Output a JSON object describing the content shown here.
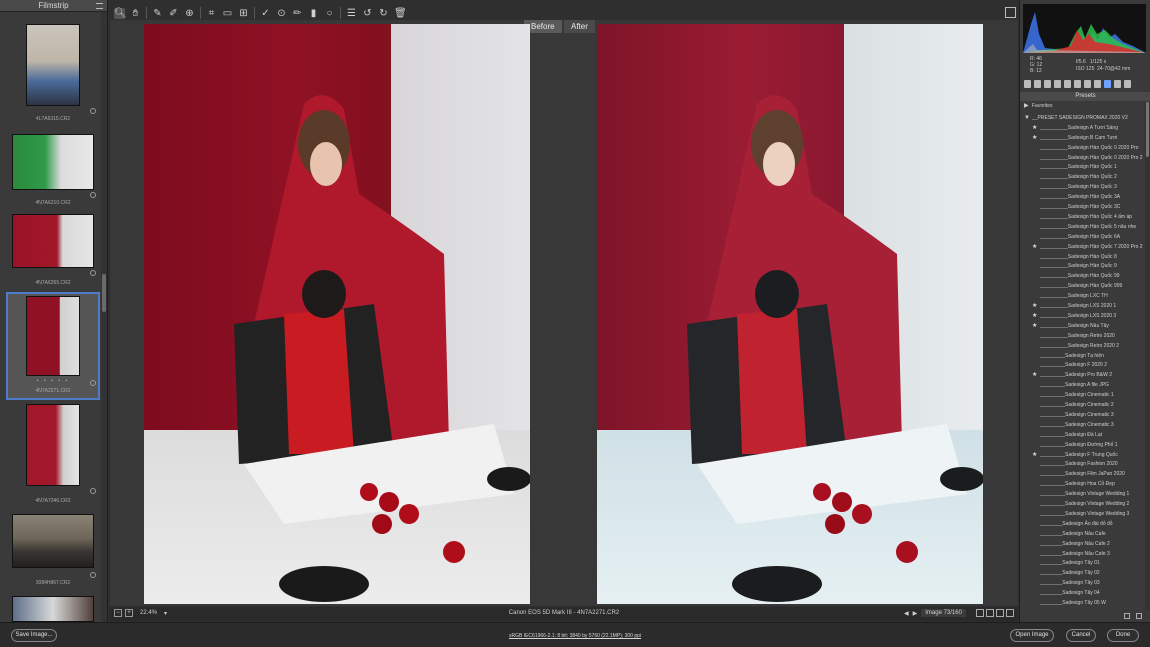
{
  "filmstrip": {
    "title": "Filmstrip",
    "thumbnails": [
      {
        "caption": "4L7A6315.CR2",
        "stars": ""
      },
      {
        "caption": "4N7A6210.CR2",
        "stars": ""
      },
      {
        "caption": "4N7A6265.CR2",
        "stars": ""
      },
      {
        "caption": "4N7A2271.CR2",
        "stars": "• • • • •"
      },
      {
        "caption": "4N7A7346.CR2",
        "stars": ""
      },
      {
        "caption": "3084H867.CR2",
        "stars": ""
      }
    ]
  },
  "compare": {
    "before_label": "Before",
    "after_label": "After"
  },
  "status": {
    "zoom": "22.4%",
    "camera": "Canon EOS 5D Mark III  -  4N7A2271.CR2",
    "counter": "Image 73/160"
  },
  "readout": {
    "r_label": "R:",
    "r_value": "46",
    "g_label": "G:",
    "g_value": "12",
    "b_label": "B:",
    "b_value": "12",
    "aperture": "f/5.6",
    "shutter": "1/125 s",
    "iso": "ISO 125",
    "lens": "24-70@42 mm"
  },
  "presets": {
    "title": "Presets",
    "favorites_label": "Favorites",
    "group_label": "__PRESET SADESIGN PROMAX 2020 V2",
    "items": [
      {
        "label": "__________Sadesign A Tươi Sáng",
        "star": true
      },
      {
        "label": "__________Sadesign B  Cam Tươi",
        "star": true
      },
      {
        "label": "__________Sadesign Hàn Quốc 0 2020 Pro",
        "star": false
      },
      {
        "label": "__________Sadesign Hàn Quốc 0 2020 Pro 2",
        "star": false
      },
      {
        "label": "__________Sadesign Hàn Quốc 1",
        "star": false
      },
      {
        "label": "__________Sadesign Hàn Quốc 2",
        "star": false
      },
      {
        "label": "__________Sadesign Hàn Quốc 3",
        "star": false
      },
      {
        "label": "__________Sadesign Hàn Quốc 3A",
        "star": false
      },
      {
        "label": "__________Sadesign Hàn Quốc 3C",
        "star": false
      },
      {
        "label": "__________Sadesign Hàn Quốc 4 ấm áp",
        "star": false
      },
      {
        "label": "__________Sadesign Hàn Quốc 5 nâu nhẹ",
        "star": false
      },
      {
        "label": "__________Sadesign Hàn Quốc 6A",
        "star": false
      },
      {
        "label": "__________Sadesign Hàn Quốc 7 2020 Pro 2",
        "star": true
      },
      {
        "label": "__________Sadesign Hàn Quốc 8",
        "star": false
      },
      {
        "label": "__________Sadesign Hàn Quốc 9",
        "star": false
      },
      {
        "label": "__________Sadesign Hàn Quốc 99",
        "star": false
      },
      {
        "label": "__________Sadesign Hàn Quốc 999",
        "star": false
      },
      {
        "label": "__________Sadesign LXC  TH",
        "star": false
      },
      {
        "label": "__________Sadesign LXS 2020 1",
        "star": true
      },
      {
        "label": "__________Sadesign LXS 2020 3",
        "star": true
      },
      {
        "label": "__________Sadesign Nâu Tây",
        "star": true
      },
      {
        "label": "__________Sadesign Retro 2020",
        "star": false
      },
      {
        "label": "__________Sadesign Retro 2020 2",
        "star": false
      },
      {
        "label": "_________Sadesign Tạ hiện",
        "star": false
      },
      {
        "label": "_________Sadesign F 2020 2",
        "star": false
      },
      {
        "label": "_________Sadesign Pro B&W 2",
        "star": true
      },
      {
        "label": "_________Sadesign A file JPG",
        "star": false
      },
      {
        "label": "_________Sadesign Cinematic 1",
        "star": false
      },
      {
        "label": "_________Sadesign Cinematic 2",
        "star": false
      },
      {
        "label": "_________Sadesign Cinematic 3",
        "star": false
      },
      {
        "label": "_________Sadesign Cinematic 3",
        "star": false
      },
      {
        "label": "_________Sadesign Đà Lạt",
        "star": false
      },
      {
        "label": "_________Sadesign Đường Phố 1",
        "star": false
      },
      {
        "label": "_________Sadesign F Trung Quốc",
        "star": true
      },
      {
        "label": "_________Sadesign Fashion 2020",
        "star": false
      },
      {
        "label": "_________Sadesign Film JaPan 2020",
        "star": false
      },
      {
        "label": "_________Sadesign Hoa Cỏ Đẹp",
        "star": false
      },
      {
        "label": "_________Sadesign Vintage Wedding 1",
        "star": false
      },
      {
        "label": "_________Sadesign Vintage Wedding 2",
        "star": false
      },
      {
        "label": "_________Sadesign Vintage Wedding 3",
        "star": false
      },
      {
        "label": "________Sadesign Ảo đài đỏ đỏ",
        "star": false
      },
      {
        "label": "________Sadesign Nâu Cafe",
        "star": false
      },
      {
        "label": "________Sadesign Nâu Cafe 2",
        "star": false
      },
      {
        "label": "________Sadesign Nâu Cafe 3",
        "star": false
      },
      {
        "label": "________Sadesign Tây 01",
        "star": false
      },
      {
        "label": "________Sadesign Tây 02",
        "star": false
      },
      {
        "label": "________Sadesign Tây 03",
        "star": false
      },
      {
        "label": "________Sadesign Tây 04",
        "star": false
      },
      {
        "label": "________Sadesign Tây 05 W",
        "star": false
      }
    ]
  },
  "bottom": {
    "save_label": "Save Image...",
    "workflow": "sRGB IEC61966-2.1; 8 bit; 3840 by 5760 (22.1MP); 300 ppi",
    "open_label": "Open Image",
    "cancel_label": "Cancel",
    "done_label": "Done"
  },
  "colors": {
    "accent": "#4e7cc9",
    "before_red": "#8f1124",
    "after_red": "#9a1c33"
  }
}
